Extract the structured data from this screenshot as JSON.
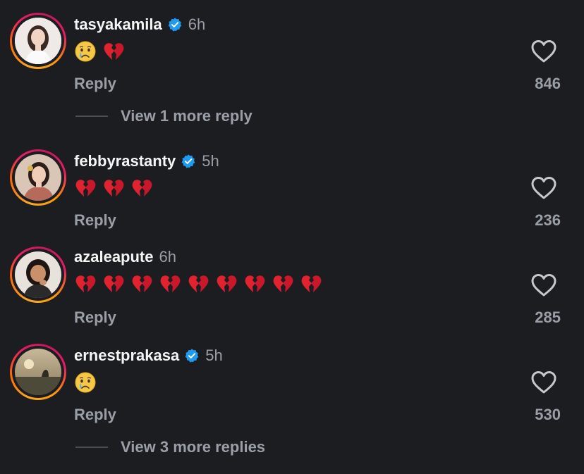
{
  "comments": [
    {
      "username": "tasyakamila",
      "verified": true,
      "time": "6h",
      "emojis": [
        "crying-face",
        "broken-heart"
      ],
      "reply_label": "Reply",
      "likes": "846",
      "more_replies": "View 1 more reply"
    },
    {
      "username": "febbyrastanty",
      "verified": true,
      "time": "5h",
      "emojis": [
        "broken-heart",
        "broken-heart",
        "broken-heart"
      ],
      "reply_label": "Reply",
      "likes": "236",
      "more_replies": ""
    },
    {
      "username": "azaleapute",
      "verified": false,
      "time": "6h",
      "emojis": [
        "broken-heart",
        "broken-heart",
        "broken-heart",
        "broken-heart",
        "broken-heart",
        "broken-heart",
        "broken-heart",
        "broken-heart",
        "broken-heart"
      ],
      "reply_label": "Reply",
      "likes": "285",
      "more_replies": ""
    },
    {
      "username": "ernestprakasa",
      "verified": true,
      "time": "5h",
      "emojis": [
        "crying-face"
      ],
      "reply_label": "Reply",
      "likes": "530",
      "more_replies": "View 3 more replies"
    }
  ],
  "colors": {
    "background": "#1b1d21",
    "username": "#f5f5f5",
    "secondary": "#9a9ea6",
    "verified": "#1d9bf0",
    "broken_heart": "#e0242f"
  },
  "icons": {
    "heart": "heart-outline-icon",
    "verified": "verified-badge-icon"
  }
}
